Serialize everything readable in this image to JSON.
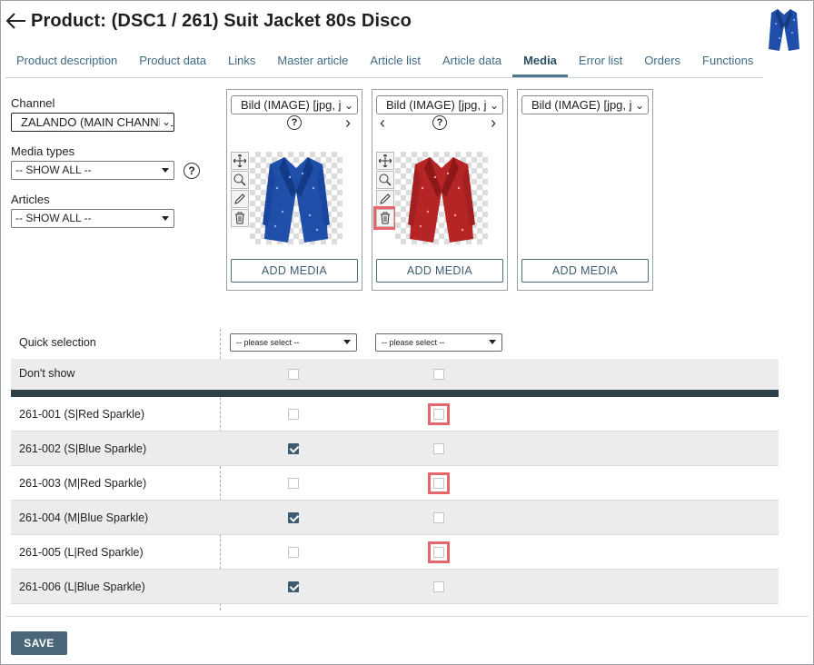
{
  "header": {
    "title": "Product: (DSC1 / 261) Suit Jacket 80s Disco"
  },
  "tabs": [
    {
      "label": "Product description"
    },
    {
      "label": "Product data"
    },
    {
      "label": "Links"
    },
    {
      "label": "Master article"
    },
    {
      "label": "Article list"
    },
    {
      "label": "Article data"
    },
    {
      "label": "Media",
      "active": true
    },
    {
      "label": "Error list"
    },
    {
      "label": "Orders"
    },
    {
      "label": "Functions"
    }
  ],
  "filters": {
    "channel_label": "Channel",
    "channel_value": "ZALANDO (MAIN CHANNEL)",
    "media_types_label": "Media types",
    "media_types_value": "-- SHOW ALL --",
    "articles_label": "Articles",
    "articles_value": "-- SHOW ALL --"
  },
  "media_cards": [
    {
      "type": "Bild (IMAGE)    [jpg, j",
      "image": "blue-sparkle-jacket",
      "add_label": "ADD MEDIA"
    },
    {
      "type": "Bild (IMAGE)    [jpg, j",
      "image": "red-sparkle-jacket",
      "add_label": "ADD MEDIA"
    },
    {
      "type": "Bild (IMAGE)    [jpg, j",
      "image": null,
      "add_label": "ADD MEDIA"
    }
  ],
  "grid": {
    "quick_selection_label": "Quick selection",
    "quick_select_placeholder": "-- please select --",
    "dont_show_label": "Don't show",
    "rows": [
      {
        "label": "261-001 (S|Red Sparkle)",
        "col1": false,
        "col2": false
      },
      {
        "label": "261-002 (S|Blue Sparkle)",
        "col1": true,
        "col2": false
      },
      {
        "label": "261-003 (M|Red Sparkle)",
        "col1": false,
        "col2": false
      },
      {
        "label": "261-004 (M|Blue Sparkle)",
        "col1": true,
        "col2": false
      },
      {
        "label": "261-005 (L|Red Sparkle)",
        "col1": false,
        "col2": false
      },
      {
        "label": "261-006 (L|Blue Sparkle)",
        "col1": true,
        "col2": false
      }
    ]
  },
  "footer": {
    "save_label": "SAVE"
  },
  "colors": {
    "accent": "#4a6678",
    "highlight": "#e8666b",
    "blue_jacket": "#1f4fa8",
    "red_jacket": "#b52525"
  }
}
